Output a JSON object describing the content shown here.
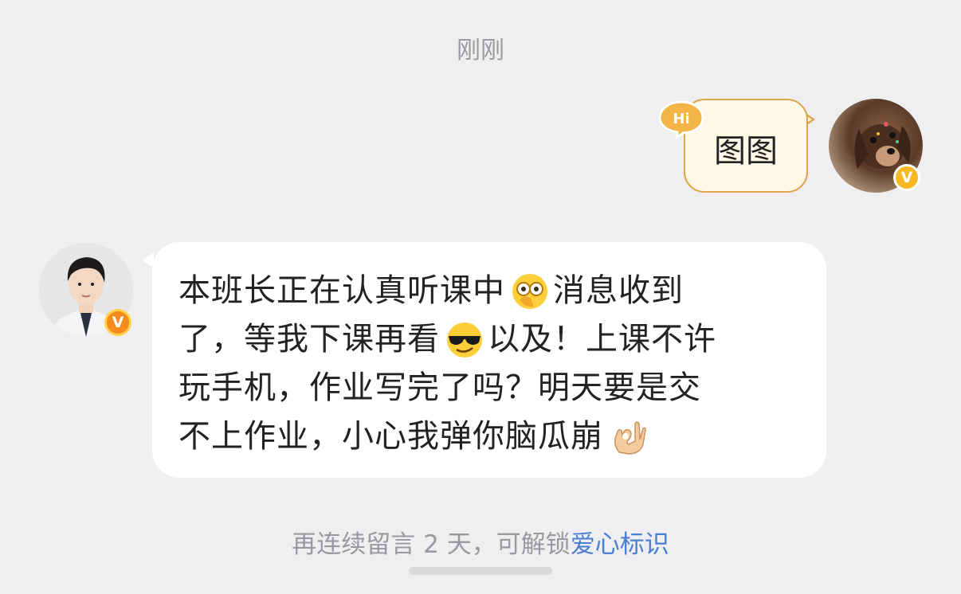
{
  "chat": {
    "timestamp": "刚刚",
    "outgoing": {
      "badge_text": "Hi",
      "text": "图图"
    },
    "incoming": {
      "lines": [
        {
          "before": "本班长正在认真听课中",
          "emoji": "peeking-face-emoji",
          "after": "消息收到"
        },
        {
          "before": "了，等我下课再看",
          "emoji": "sunglasses-face-emoji",
          "after": "以及！上课不许"
        },
        {
          "before": "玩手机，作业写完了吗？明天要是交",
          "emoji": "",
          "after": ""
        },
        {
          "before": "不上作业，小心我弹你脑瓜崩",
          "emoji": "ok-hand-emoji",
          "after": ""
        }
      ]
    },
    "footer": {
      "prefix": "再连续留言 2 天，可解锁",
      "link": "爱心标识"
    },
    "badges": {
      "right_avatar_badge": "V",
      "left_avatar_badge": "V"
    },
    "colors": {
      "background": "#efeff1",
      "outgoing_bubble": "#fff8e6",
      "outgoing_border": "#e0a24a",
      "incoming_bubble": "#ffffff",
      "link": "#4a7fd1",
      "muted_text": "#9a9a9e"
    }
  }
}
